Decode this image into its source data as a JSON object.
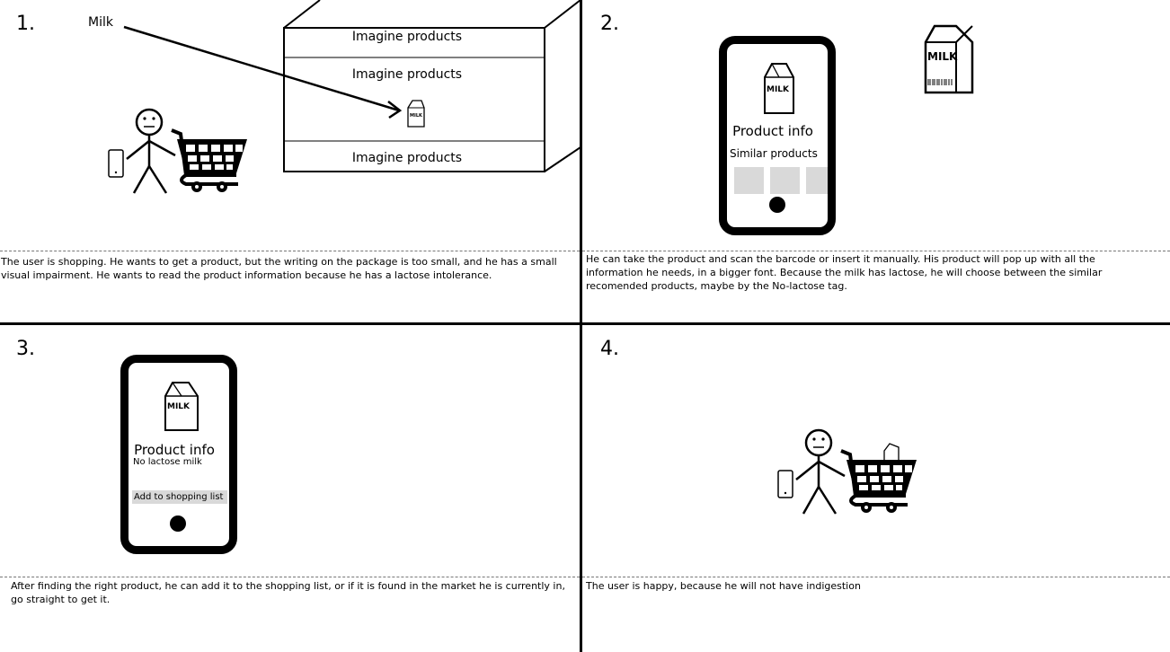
{
  "panels": [
    {
      "number": "1.",
      "caption": "The user is shopping. He wants to get a product, but the writing on the package is too small, and he has a small visual impairment. He wants to read the product information because he has a lactose intolerance.",
      "arrow_label": "Milk",
      "shelf_labels": [
        "Imagine products",
        "Imagine products",
        "Imagine products"
      ],
      "carton_text": "MILK"
    },
    {
      "number": "2.",
      "caption": "He can take the product and scan the barcode or insert it manually. His product will pop up with all the information he needs, in a bigger font. Because the milk has lactose, he will choose between the similar recomended products, maybe by the No-lactose tag.",
      "phone_title": "Product info",
      "phone_subtitle": "Similar products",
      "carton_text": "MILK"
    },
    {
      "number": "3.",
      "caption": "After finding the right product, he can add it to the shopping list, or if it is found in the market he is currently in, go straight to get it.",
      "phone_title": "Product info",
      "phone_subtitle": "No lactose milk",
      "phone_button": "Add to shopping list",
      "carton_text": "MILK"
    },
    {
      "number": "4.",
      "caption": "The user is happy, because he will not have indigestion"
    }
  ]
}
